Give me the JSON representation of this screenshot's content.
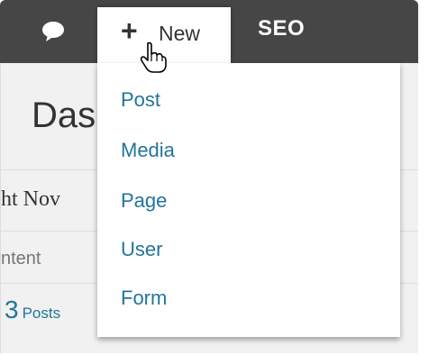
{
  "adminbar": {
    "comments_icon": "speech-bubble-icon",
    "new_plus": "+",
    "new_label": "New",
    "seo_label": "SEO"
  },
  "dashboard": {
    "title": "Das",
    "right_now": "ht Nov",
    "content_label": "ntent",
    "posts_count": "3",
    "posts_label": "Posts"
  },
  "dropdown": {
    "items": [
      "Post",
      "Media",
      "Page",
      "User",
      "Form"
    ]
  },
  "colors": {
    "adminbar_bg": "#464646",
    "link": "#21759b",
    "dashboard_bg": "#f1f1f1"
  }
}
